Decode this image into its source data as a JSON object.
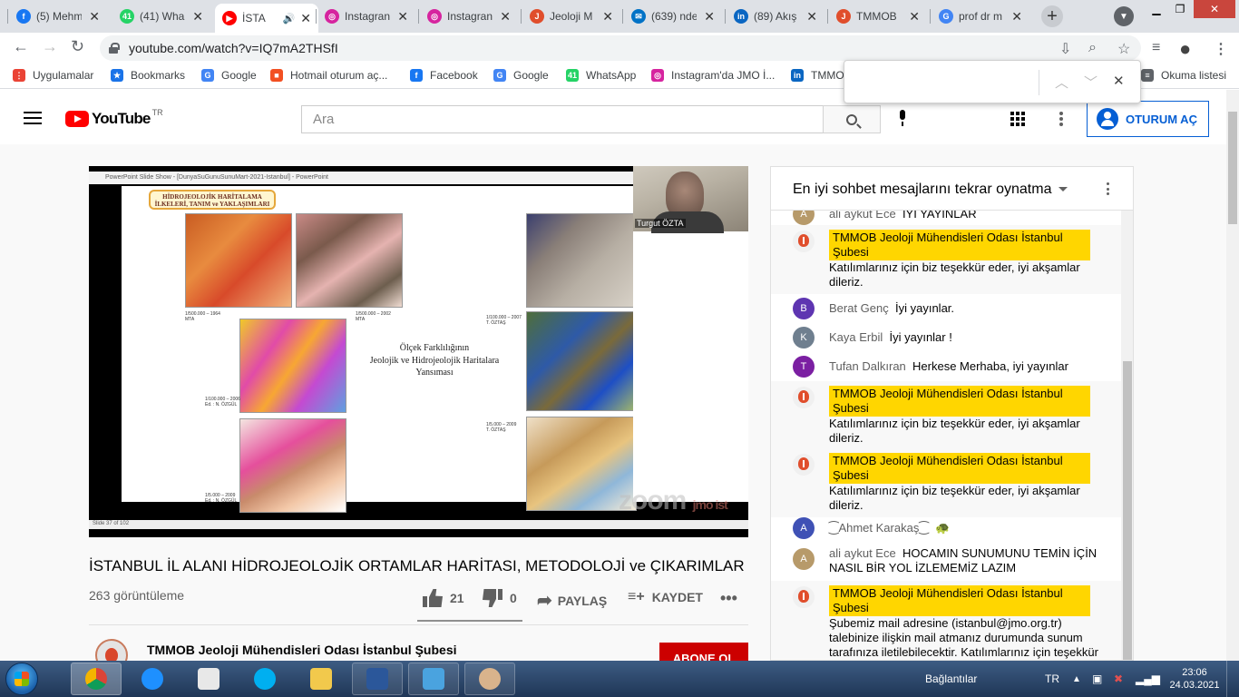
{
  "browser": {
    "tabs": [
      {
        "title": "(5) Mehm",
        "icon": "facebook-icon",
        "color": "#1877f2",
        "glyph": "f"
      },
      {
        "title": "(41) Wha",
        "icon": "whatsapp-icon",
        "color": "#25d366",
        "glyph": "41"
      },
      {
        "title": "İSTA",
        "icon": "youtube-icon",
        "color": "#ff0000",
        "glyph": "▶"
      },
      {
        "title": "Instagran",
        "icon": "instagram-icon",
        "color": "#d6249f",
        "glyph": "◎"
      },
      {
        "title": "Instagran",
        "icon": "instagram-icon",
        "color": "#d6249f",
        "glyph": "◎"
      },
      {
        "title": "Jeoloji M",
        "icon": "jmo-icon",
        "color": "#e04e2c",
        "glyph": "J"
      },
      {
        "title": "(639) nde",
        "icon": "mail-icon",
        "color": "#0072c6",
        "glyph": "✉"
      },
      {
        "title": "(89) Akış",
        "icon": "linkedin-icon",
        "color": "#0a66c2",
        "glyph": "in"
      },
      {
        "title": "TMMOB",
        "icon": "jmo-icon",
        "color": "#e04e2c",
        "glyph": "J"
      },
      {
        "title": "prof dr m",
        "icon": "google-icon",
        "color": "#4285f4",
        "glyph": "G"
      }
    ],
    "url": "youtube.com/watch?v=IQ7mA2THSfI",
    "bookmarks": [
      {
        "label": "Uygulamalar",
        "icon": "apps-grid-icon",
        "color": "#ea4335",
        "glyph": "⋮"
      },
      {
        "label": "Bookmarks",
        "icon": "star-icon",
        "color": "#1a73e8",
        "glyph": "★"
      },
      {
        "label": "Google",
        "icon": "google-icon",
        "color": "#4285f4",
        "glyph": "G"
      },
      {
        "label": "Hotmail oturum aç...",
        "icon": "microsoft-icon",
        "color": "#f25022",
        "glyph": "■"
      },
      {
        "label": "Facebook",
        "icon": "facebook-icon",
        "color": "#1877f2",
        "glyph": "f"
      },
      {
        "label": "Google",
        "icon": "google-icon",
        "color": "#4285f4",
        "glyph": "G"
      },
      {
        "label": "WhatsApp",
        "icon": "whatsapp-icon",
        "color": "#25d366",
        "glyph": "41"
      },
      {
        "label": "Instagram'da JMO İ...",
        "icon": "instagram-icon",
        "color": "#d6249f",
        "glyph": "◎"
      },
      {
        "label": "TMMO",
        "icon": "linkedin-icon",
        "color": "#0a66c2",
        "glyph": "in"
      }
    ],
    "reading_list": "Okuma listesi"
  },
  "youtube": {
    "logo_word": "YouTube",
    "country": "TR",
    "search_placeholder": "Ara",
    "signin_label": "OTURUM AÇ"
  },
  "video": {
    "title": "İSTANBUL İL ALANI HİDROJEOLOJİK ORTAMLAR HARİTASI, METODOLOJİ ve ÇIKARIMLAR",
    "views": "263 görüntüleme",
    "likes": "21",
    "dislikes": "0",
    "share_label": "PAYLAŞ",
    "save_label": "KAYDET",
    "slide": {
      "window_caption": "PowerPoint Slide Show - [DunyaSuGunuSunuMart-2021-Istanbul] - PowerPoint",
      "title_line1": "HİDROJEOLOJİK HARİTALAMA",
      "title_line2": "İLKELERİ, TANIM ve YAKLAŞIMLARI",
      "caption_line1": "Ölçek Farklılığının",
      "caption_line2": "Jeolojik ve Hidrojeolojik Haritalara",
      "caption_line3": "Yansıması",
      "scale1": "1/500.000 – 1964",
      "scale1_src": "MTA",
      "scale2": "1/500.000 – 2002",
      "scale2_src": "MTA",
      "scale3": "1/100.000 – 2006",
      "scale3_src": "Ed. : N. ÖZGÜL",
      "scale4": "1/5.000 – 2009",
      "scale4_src": "Ed. : N. ÖZGÜL",
      "scale5": "1/100.000 – 2007",
      "scale5_src": "T. ÖZTAŞ",
      "scale6": "1/5.000 – 2009",
      "scale6_src": "T. ÖZTAŞ",
      "slide_number": "Slide 37 of 102",
      "participant_name": "Turgut ÖZTA",
      "zoom_watermark": "zoom",
      "zoom_badge": "jmo ist"
    }
  },
  "channel": {
    "name": "TMMOB Jeoloji Mühendisleri Odası İstanbul Şubesi",
    "subscribe_label": "ABONE OL"
  },
  "chat": {
    "header": "En iyi sohbet mesajlarını tekrar oynatma",
    "messages": [
      {
        "author": "ali aykut Ece",
        "text": "İYİ YAYINLAR",
        "avatar": "A",
        "color": "#b79a6a"
      },
      {
        "author": "TMMOB Jeoloji Mühendisleri Odası İstanbul Şubesi",
        "text": "Katılımlarınız için biz teşekkür eder, iyi akşamlar dileriz."
      },
      {
        "author": "Berat Genç",
        "text": "İyi yayınlar.",
        "avatar": "B",
        "color": "#5e35b1"
      },
      {
        "author": "Kaya Erbil",
        "text": "İyi yayınlar !",
        "avatar": "K",
        "color": "#6f7f8f"
      },
      {
        "author": "Tufan Dalkıran",
        "text": "Herkese Merhaba, iyi yayınlar",
        "avatar": "T",
        "color": "#7b1fa2"
      },
      {
        "author": "TMMOB Jeoloji Mühendisleri Odası İstanbul Şubesi",
        "text": "Katılımlarınız için biz teşekkür eder, iyi akşamlar dileriz."
      },
      {
        "author": "TMMOB Jeoloji Mühendisleri Odası İstanbul Şubesi",
        "text": "Katılımlarınız için biz teşekkür eder, iyi akşamlar dileriz."
      },
      {
        "author": "⁐Ahmet Karakaş⁐",
        "text": "🐢",
        "avatar": "A",
        "color": "#3f51b5"
      },
      {
        "author": "ali aykut Ece",
        "text": "HOCAMIN SUNUMUNU TEMİN İÇİN NASIL BİR YOL İZLEMEMİZ LAZIM",
        "avatar": "A",
        "color": "#b79a6a"
      },
      {
        "author": "TMMOB Jeoloji Mühendisleri Odası İstanbul Şubesi",
        "text": "Şubemiz mail adresine (istanbul@jmo.org.tr) talebinize ilişkin mail atmanız durumunda sunum tarafınıza iletilebilecektir. Katılımlarınız için teşekkür eder, iyi akşamlar dileriz."
      }
    ]
  },
  "taskbar": {
    "links_label": "Bağlantılar",
    "lang": "TR",
    "time": "23:06",
    "date": "24.03.2021"
  }
}
